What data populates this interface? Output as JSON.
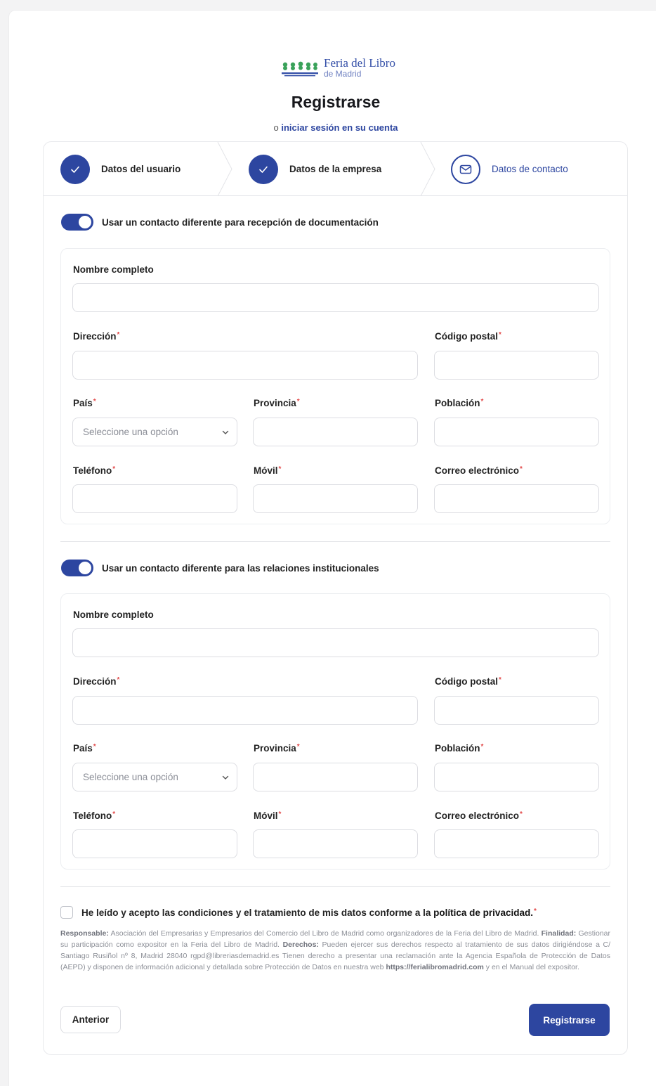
{
  "brand": {
    "line1": "Feria del Libro",
    "line2": "de Madrid",
    "accent": "#2d46a0",
    "logo_green": "#3aa25a"
  },
  "header": {
    "title": "Registrarse",
    "subtitle_prefix": "o",
    "login_link": "iniciar sesión en su cuenta"
  },
  "steps": [
    {
      "label": "Datos del usuario",
      "state": "done",
      "icon": "check-icon"
    },
    {
      "label": "Datos de la empresa",
      "state": "done",
      "icon": "check-icon"
    },
    {
      "label": "Datos de contacto",
      "state": "current",
      "icon": "mail-icon"
    }
  ],
  "sections": [
    {
      "toggle_label": "Usar un contacto diferente para recepción de documentación",
      "toggle_on": true
    },
    {
      "toggle_label": "Usar un contacto diferente para las relaciones institucionales",
      "toggle_on": true
    }
  ],
  "fields": {
    "full_name": "Nombre completo",
    "address": "Dirección",
    "postal_code": "Código postal",
    "country": "País",
    "province": "Provincia",
    "town": "Población",
    "phone": "Teléfono",
    "mobile": "Móvil",
    "email": "Correo electrónico",
    "required_mark": "*",
    "country_placeholder": "Seleccione una opción"
  },
  "consent": {
    "text": "He leído y acepto las condiciones y el tratamiento de mis datos conforme a la",
    "link": "política de privacidad.",
    "required_mark": "*"
  },
  "legal": {
    "responsable_label": "Responsable:",
    "responsable_text": "Asociación del Empresarias y Empresarios del Comercio del Libro de Madrid como organizadores de la Feria del Libro de Madrid.",
    "finalidad_label": "Finalidad:",
    "finalidad_text": "Gestionar su participación como expositor en la Feria del Libro de Madrid.",
    "derechos_label": "Derechos:",
    "derechos_text": "Pueden ejercer sus derechos respecto al tratamiento de sus datos dirigiéndose a C/ Santiago Rusiñol nº 8, Madrid 28040 rgpd@libreriasdemadrid.es Tienen derecho a presentar una reclamación ante la Agencia Española de Protección de Datos (AEPD) y disponen de información adicional y detallada sobre Protección de Datos en nuestra web",
    "web": "https://ferialibromadrid.com",
    "tail": "y en el Manual del expositor."
  },
  "buttons": {
    "previous": "Anterior",
    "submit": "Registrarse"
  }
}
